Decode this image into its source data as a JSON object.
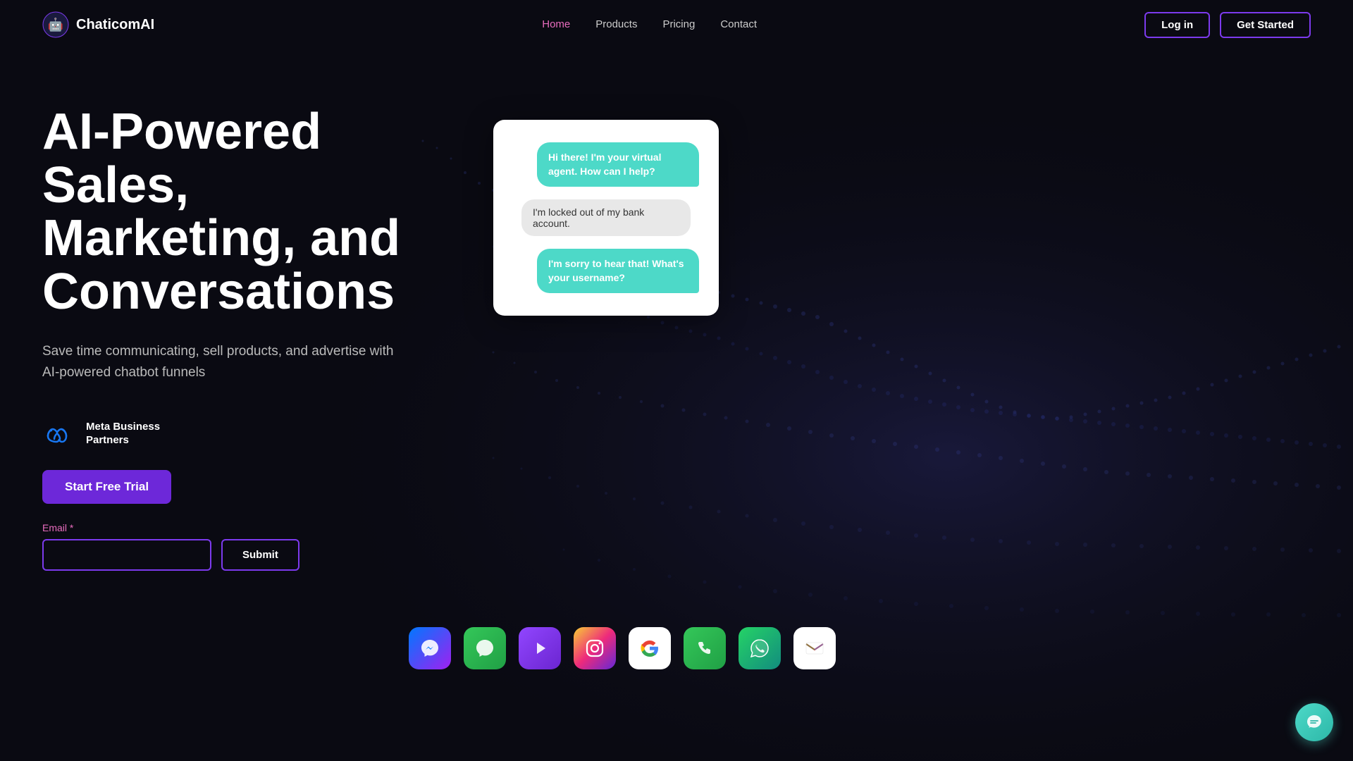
{
  "logo": {
    "text": "ChaticomAI",
    "icon": "🤖"
  },
  "nav": {
    "links": [
      {
        "label": "Home",
        "href": "#",
        "active": true
      },
      {
        "label": "Products",
        "href": "#",
        "active": false
      },
      {
        "label": "Pricing",
        "href": "#",
        "active": false
      },
      {
        "label": "Contact",
        "href": "#",
        "active": false
      }
    ],
    "login_label": "Log in",
    "get_started_label": "Get Started"
  },
  "hero": {
    "title": "AI-Powered Sales, Marketing, and Conversations",
    "subtitle": "Save time communicating, sell products, and advertise with AI-powered chatbot funnels",
    "meta_badge_text": "Meta Business\nPartners",
    "trial_button": "Start Free Trial",
    "email_label": "Email",
    "email_placeholder": "",
    "submit_label": "Submit"
  },
  "chat": {
    "message1": "Hi there! I'm your virtual agent. How can I help?",
    "message2": "I'm locked out of my bank account.",
    "message3": "I'm sorry to hear that! What's your username?"
  },
  "app_icons": [
    {
      "name": "Messenger",
      "class": "app-icon-messenger",
      "symbol": "💬"
    },
    {
      "name": "iMessage",
      "class": "app-icon-imessage",
      "symbol": "💬"
    },
    {
      "name": "Twitch",
      "class": "app-icon-twitch",
      "symbol": "▶"
    },
    {
      "name": "Instagram",
      "class": "app-icon-instagram",
      "symbol": "📷"
    },
    {
      "name": "Google",
      "class": "app-icon-google",
      "symbol": "G"
    },
    {
      "name": "Phone",
      "class": "app-icon-phone",
      "symbol": "📞"
    },
    {
      "name": "WhatsApp",
      "class": "app-icon-whatsapp",
      "symbol": "💬"
    },
    {
      "name": "Gmail",
      "class": "app-icon-gmail",
      "symbol": "M"
    }
  ]
}
